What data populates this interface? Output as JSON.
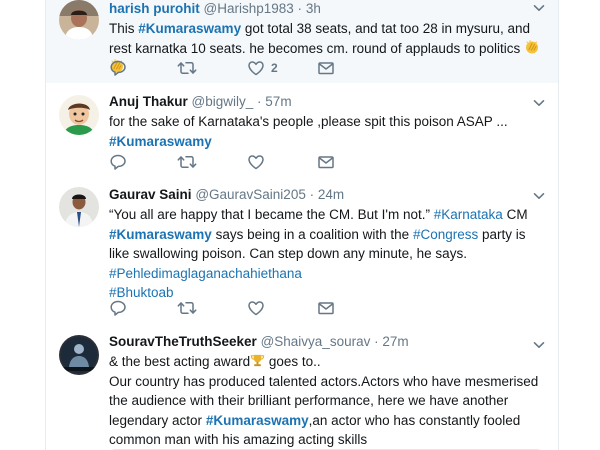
{
  "tweets": [
    {
      "name": "harish purohit",
      "handle": "@Harishp1983",
      "sep": "·",
      "time": "3h",
      "text_parts": [
        "This  ",
        "#Kumaraswamy",
        " got total 38 seats, and tat too 28 in mysuru, and rest karnatka 10 seats. he becomes cm. round of applauds to politics "
      ],
      "likes": "2"
    },
    {
      "name": "Anuj Thakur",
      "handle": "@bigwily_",
      "sep": "·",
      "time": "57m",
      "text": "for the sake of Karnataka's people ,please spit this poison ASAP ...",
      "hashtag": "#Kumaraswamy"
    },
    {
      "name": "Gaurav Saini",
      "handle": "@GauravSaini205",
      "sep": "·",
      "time": "24m",
      "p1": "“You all are happy that I became the CM. But I'm not.” ",
      "tag1": "#Karnataka",
      "p2": " CM ",
      "tag2": "#Kumaraswamy",
      "p3": " says being in a coalition with the ",
      "tag3": "#Congress",
      "p4": " party is like swallowing poison. Can step down any minute, he says.",
      "tag4": "#Pehledimaglaganachahiethana",
      "tag5": "#Bhuktoab"
    },
    {
      "name": "SouravTheTruthSeeker",
      "handle": "@Shaivya_sourav",
      "sep": "·",
      "time": "27m",
      "line1": "& the best acting award",
      "line1b": " goes to..",
      "p1": "Our country has produced talented actors.Actors who have mesmerised the audience with their brilliant performance, here we have another legendary actor ",
      "tag": "#Kumaraswamy",
      "p2": ",an actor who has constantly fooled common man with his amazing acting skills"
    }
  ],
  "icons": {
    "reply": "reply-icon",
    "retweet": "retweet-icon",
    "like": "heart-icon",
    "dm": "envelope-icon",
    "more": "chevron-down-icon"
  },
  "colors": {
    "link": "#1b73b3",
    "secondary": "#657786",
    "border": "#e6ecf0",
    "highlight_bg": "#f5f8fa"
  }
}
